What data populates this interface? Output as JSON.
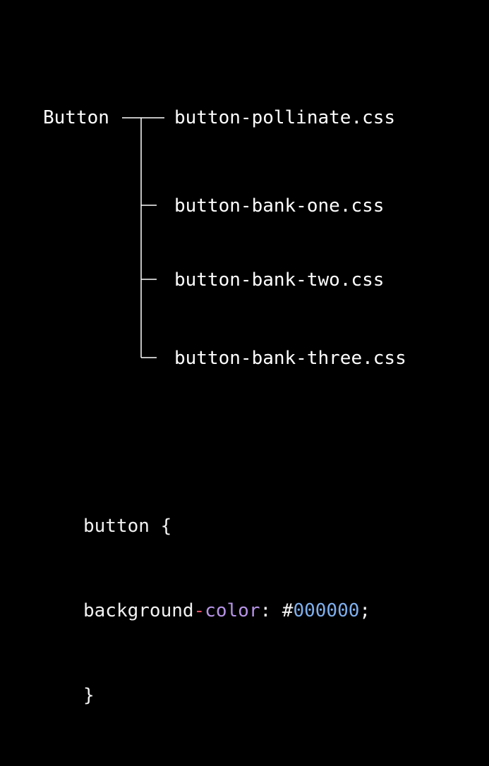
{
  "tree": {
    "root": "Button",
    "files": [
      "button-pollinate.css",
      "button-bank-one.css",
      "button-bank-two.css",
      "button-bank-three.css"
    ]
  },
  "code": {
    "line1": "button {",
    "line2": {
      "prop_start": "background",
      "dash": "-",
      "prop_end": "color",
      "colon": ": #",
      "value": "000000",
      "semicolon": ";"
    },
    "line3": "}"
  },
  "colors": {
    "background": "#000000",
    "text": "#ffffff",
    "dash": "#e2546a",
    "property": "#b794e6",
    "hex_value": "#7fb0ee"
  }
}
